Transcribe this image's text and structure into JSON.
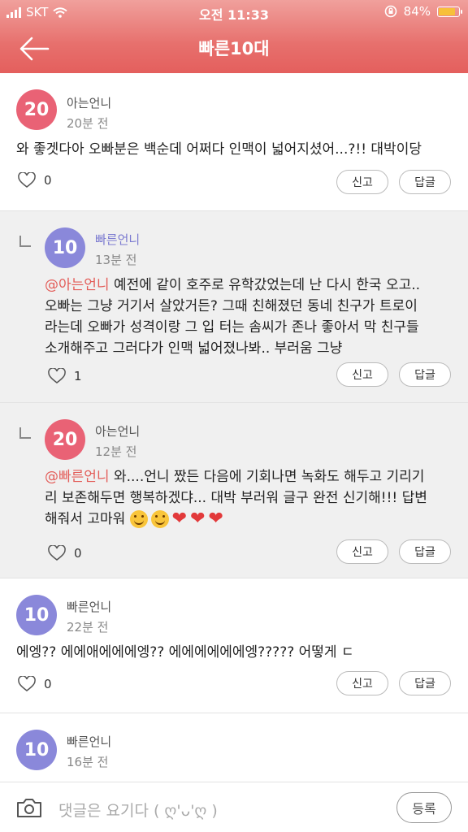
{
  "status": {
    "carrier": "SKT",
    "time": "오전 11:33",
    "battery": "84%",
    "battery_level": 0.84
  },
  "header": {
    "title": "빠른10대"
  },
  "comments": [
    {
      "badge": "20",
      "user": "아는언니",
      "time": "20분 전",
      "text": "와 좋겟다아 오빠분은 백순데 어쩌다 인맥이 넓어지셨어...?!! 대박이당",
      "likes": "0",
      "report": "신고",
      "reply": "답글"
    },
    {
      "badge": "10",
      "user": "빠른언니",
      "time": "13분 전",
      "mention": "@아는언니",
      "line1": " 예전에 같이 호주로 유학갔었는데 난 다시 한국 오고..",
      "line2": "오빠는 그냥 거기서 살았거든? 그때 친해졌던 동네 친구가 트로이",
      "line3": "라는데 오빠가 성격이랑 그 입 터는 솜씨가 존나 좋아서 막 친구들",
      "line4": "소개해주고 그러다가 인맥 넓어졌나봐.. 부러움 그냥",
      "likes": "1",
      "report": "신고",
      "reply": "답글"
    },
    {
      "badge": "20",
      "user": "아는언니",
      "time": "12분 전",
      "mention": "@빠른언니",
      "line1": " 와....언니 짰든 다음에 기회나면 녹화도 해두고 기리기",
      "line2": "리 보존해두면 행복하겠댜... 대박 부러워 글구 완전 신기해!!! 답변",
      "line3": "해줘서 고마워",
      "likes": "0",
      "report": "신고",
      "reply": "답글"
    },
    {
      "badge": "10",
      "user": "빠른언니",
      "time": "22분 전",
      "text": "에엥?? 에에애에에에엥?? 에에에에에에엥????? 어떻게 ㄷ",
      "likes": "0",
      "report": "신고",
      "reply": "답글"
    },
    {
      "badge": "10",
      "user": "빠른언니",
      "time": "16분 전"
    }
  ],
  "input": {
    "placeholder": "댓글은 요기다 ( ღ'ᴗ'ღ )",
    "submit": "등록"
  },
  "colors": {
    "header": "#e45f5d",
    "badge20": "#e96275",
    "badge10": "#8a88da",
    "mention": "#e35d59"
  },
  "icons": [
    "back-arrow-icon",
    "wifi-icon",
    "lock-rotation-icon",
    "heart-outline-icon",
    "reply-indent-icon",
    "camera-icon"
  ]
}
